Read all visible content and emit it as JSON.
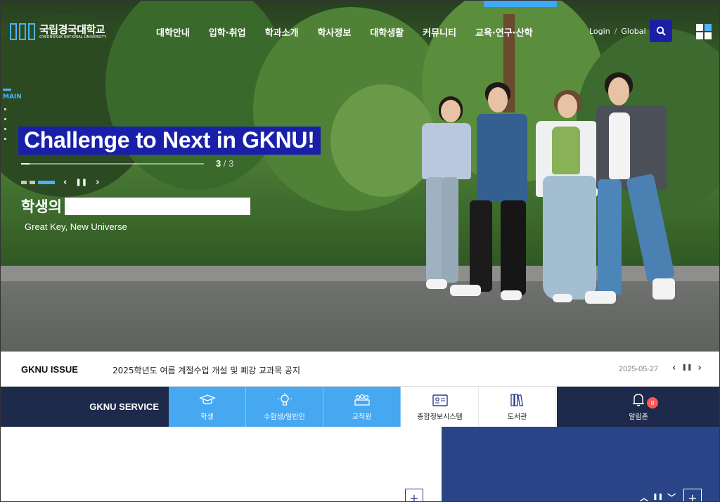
{
  "logo": {
    "name_ko": "국립경국대학교",
    "name_en": "GYEONGKUK NATIONAL UNIVERSITY"
  },
  "nav": {
    "items": [
      {
        "label": "대학안내"
      },
      {
        "label": "입학·취업"
      },
      {
        "label": "학과소개"
      },
      {
        "label": "학사정보"
      },
      {
        "label": "대학생활"
      },
      {
        "label": "커뮤니티"
      },
      {
        "label": "교육·연구·산학"
      }
    ],
    "login": "Login",
    "separator": "/",
    "global": "Global",
    "search_icon": "search-icon",
    "sitemap_icon": "grid-icon"
  },
  "hero": {
    "side_label": "MAIN",
    "headline": "Challenge to Next in GKNU!",
    "counter_current": "3",
    "counter_separator": "/",
    "counter_total": "3",
    "prev_label": "‹",
    "pause_label": "❚❚",
    "next_label": "›",
    "sub_ko": "학생의",
    "sub_en": "Great Key, New Universe"
  },
  "issue": {
    "title": "GKNU ISSUE",
    "text": "2025학년도 여름 계절수업 개설 및 폐강 교과목 공지",
    "date": "2025-05-27",
    "prev_label": "‹",
    "pause_label": "❚❚",
    "next_label": "›"
  },
  "service": {
    "title": "GKNU SERVICE",
    "items": [
      {
        "label": "학생",
        "icon": "graduation-cap-icon"
      },
      {
        "label": "수험생/일반인",
        "icon": "lightbulb-icon"
      },
      {
        "label": "교직원",
        "icon": "people-icon"
      },
      {
        "label": "종합정보시스템",
        "icon": "id-card-icon"
      },
      {
        "label": "도서관",
        "icon": "books-icon"
      },
      {
        "label": "알림존",
        "icon": "bell-icon"
      }
    ],
    "badge_count": "0"
  },
  "bottom": {
    "left_plus": "+",
    "right_plus": "+",
    "up_label": "︿",
    "pause_label": "❚❚",
    "down_label": "﹀"
  },
  "colors": {
    "accent_blue": "#45a8f0",
    "navy": "#1d2a4b",
    "headline_bg": "#1a1faa",
    "panel_blue": "#2a4587",
    "badge_red": "#ff5757"
  }
}
